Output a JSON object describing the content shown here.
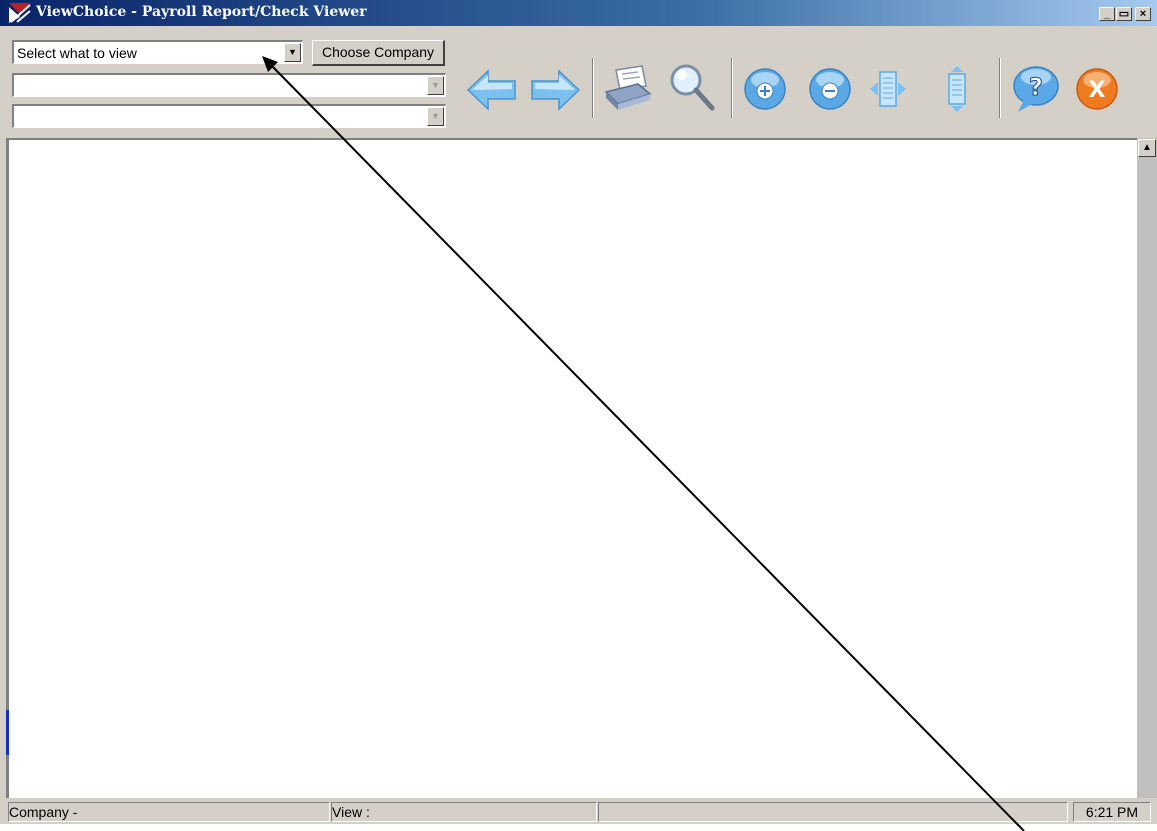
{
  "window": {
    "title": "ViewChoice - Payroll Report/Check Viewer",
    "controls": {
      "minimize": "_",
      "maximize": "▭",
      "close": "×"
    }
  },
  "toolbar": {
    "view_select": {
      "value": "Select what to view"
    },
    "choose_company_label": "Choose Company",
    "combo2": {
      "value": ""
    },
    "combo3": {
      "value": ""
    },
    "buttons": [
      {
        "name": "back-button",
        "icon": "arrow-left-icon"
      },
      {
        "name": "forward-button",
        "icon": "arrow-right-icon"
      },
      {
        "name": "print-button",
        "icon": "printer-icon"
      },
      {
        "name": "search-button",
        "icon": "magnifier-icon"
      },
      {
        "name": "zoom-in-button",
        "icon": "plus-circle-icon"
      },
      {
        "name": "zoom-out-button",
        "icon": "minus-circle-icon"
      },
      {
        "name": "fit-width-button",
        "icon": "fit-width-icon"
      },
      {
        "name": "fit-page-button",
        "icon": "fit-page-icon"
      },
      {
        "name": "help-button",
        "icon": "help-icon"
      },
      {
        "name": "exit-button",
        "icon": "exit-icon"
      }
    ]
  },
  "status": {
    "company": "Company -",
    "view": "View :",
    "blank": "",
    "time": "6:21 PM"
  },
  "colors": {
    "title_bar_start": "#0a246a",
    "title_bar_end": "#a6caf0",
    "face": "#d4d0c8",
    "accent_blue": "#5aa8e6",
    "exit_orange": "#f07a20"
  }
}
